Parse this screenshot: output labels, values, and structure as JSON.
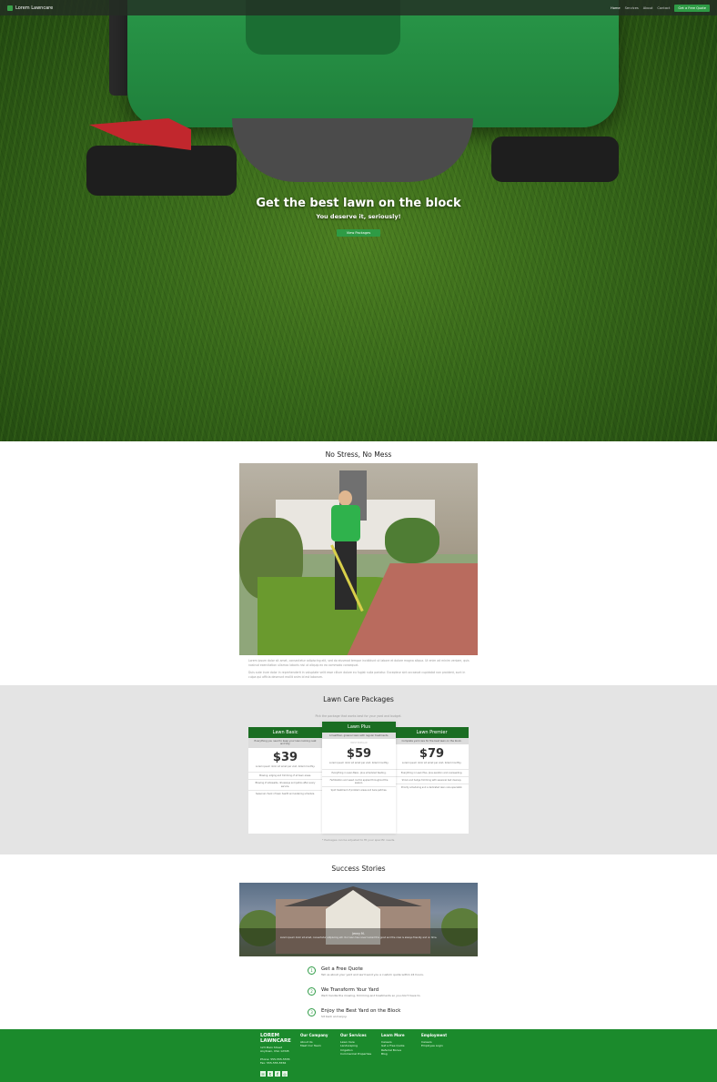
{
  "nav": {
    "brand": "Lorem Lawncare",
    "links": [
      "Home",
      "Services",
      "About",
      "Contact"
    ],
    "cta": "Get a Free Quote"
  },
  "hero": {
    "title": "Get the best lawn on the block",
    "subtitle": "You deserve it, seriously!",
    "button": "View Packages"
  },
  "stress": {
    "title": "No Stress, No Mess",
    "paragraphs": [
      "Lorem ipsum dolor sit amet, consectetur adipiscing elit, sed do eiusmod tempor incididunt ut labore et dolore magna aliqua. Ut enim ad minim veniam, quis nostrud exercitation ullamco laboris nisi ut aliquip ex ea commodo consequat.",
      "Duis aute irure dolor in reprehenderit in voluptate velit esse cillum dolore eu fugiat nulla pariatur. Excepteur sint occaecat cupidatat non proident, sunt in culpa qui officia deserunt mollit anim id est laborum."
    ]
  },
  "packages": {
    "title": "Lawn Care Packages",
    "intro": "Pick the package that works best for your yard and budget.",
    "note": "* Packages can be adjusted to fit your specific needs.",
    "cards": [
      {
        "name": "Lawn Basic",
        "desc": "Everything you need to keep your lawn looking neat and tidy.",
        "price": "$39",
        "tag": "Lorem ipsum dolor sit amet per visit, billed monthly.",
        "features": [
          "Mowing, edging and trimming of all lawn areas.",
          "Blowing of sidewalks, driveways and patios after every service.",
          "Seasonal check of lawn health and watering schedule."
        ]
      },
      {
        "name": "Lawn Plus",
        "desc": "A healthier, greener lawn with regular treatments.",
        "placeholder": "MOST POPULAR",
        "price": "$59",
        "tag": "Lorem ipsum dolor sit amet per visit, billed monthly.",
        "features": [
          "Everything in Lawn Basic, plus scheduled feeding.",
          "Fertilization and weed control applied throughout the season.",
          "Spot treatment of problem areas and bare patches."
        ]
      },
      {
        "name": "Lawn Premier",
        "desc": "Complete yard care for the best lawn on the block.",
        "price": "$79",
        "tag": "Lorem ipsum dolor sit amet per visit, billed monthly.",
        "features": [
          "Everything in Lawn Plus, plus aeration and overseeding.",
          "Shrub and hedge trimming with seasonal bed cleanup.",
          "Priority scheduling and a dedicated lawn care specialist."
        ]
      }
    ]
  },
  "success": {
    "title": "Success Stories",
    "slide_name": "Jenny M.",
    "slide_text": "Lorem ipsum dolor sit amet, consectetur adipiscing elit. Our lawn has never looked this good and the crew is always friendly and on time.",
    "steps": [
      {
        "num": "1",
        "title": "Get a Free Quote",
        "text": "Tell us about your yard and we'll send you a custom quote within 24 hours."
      },
      {
        "num": "2",
        "title": "We Transform Your Yard",
        "text": "We'll handle the mowing, trimming and treatments so you don't have to."
      },
      {
        "num": "3",
        "title": "Enjoy the Best Yard on the Block",
        "text": "Sit back and enjoy."
      }
    ]
  },
  "footer": {
    "brand_line1": "LOREM",
    "brand_line2": "LAWNCARE",
    "addr1": "123 Main Street",
    "addr2": "Anytown, USA 12345",
    "phone": "Phone: 555-555-5555",
    "fax": "Fax: 555-555-5556",
    "social_icons": [
      "mail-icon",
      "twitter-icon",
      "facebook-icon",
      "instagram-icon"
    ],
    "columns": [
      {
        "heading": "Our Company",
        "items": [
          "About Us",
          "Meet Our Team"
        ]
      },
      {
        "heading": "Our Services",
        "items": [
          "Lawn Care",
          "Landscaping",
          "Irrigation",
          "Commercial Properties"
        ]
      },
      {
        "heading": "Learn More",
        "items": [
          "Careers",
          "Get a Free Quote",
          "Referral Bonus",
          "Blog"
        ]
      },
      {
        "heading": "Employment",
        "items": [
          "Careers",
          "Employee Login"
        ]
      }
    ]
  },
  "colors": {
    "brand_green": "#2e9b45",
    "card_head": "#1a6d22",
    "footer_green": "#1b8a2c",
    "packages_bg": "#e4e4e4"
  }
}
